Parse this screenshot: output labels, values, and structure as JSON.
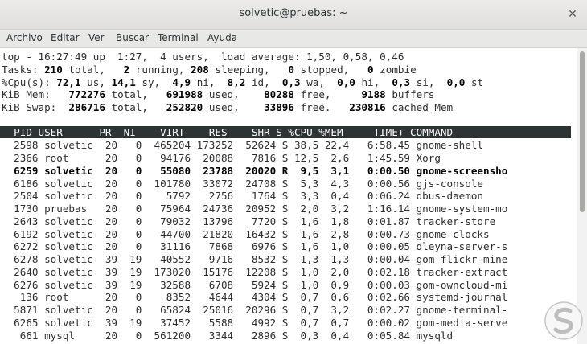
{
  "window": {
    "title": "solvetic@pruebas: ~"
  },
  "menu": [
    "Archivo",
    "Editar",
    "Ver",
    "Buscar",
    "Terminal",
    "Ayuda"
  ],
  "summary": [
    "top - 16:27:49 up  1:27,  4 users,  load average: 1,50, 0,58, 0,46",
    "Tasks: <b>210</b> total,   <b>2</b> running, <b>208</b> sleeping,   <b>0</b> stopped,   <b>0</b> zombie",
    "%Cpu(s): <b>72,1</b> us, <b>14,1</b> sy,  <b>4,9</b> ni,  <b>8,2</b> id,  <b>0,3</b> wa,  <b>0,0</b> hi,  <b>0,3</b> si,  <b>0,0</b> st",
    "KiB Mem:   <b>772276</b> total,   <b>691988</b> used,    <b>80288</b> free,     <b>9188</b> buffers",
    "KiB Swap:  <b>286716</b> total,   <b>252820</b> used,    <b>33896</b> free.   <b>230816</b> cached Mem"
  ],
  "table_header": "  PID USER      PR  NI    VIRT    RES    SHR S %CPU %MEM     TIME+ COMMAND",
  "processes": [
    "  2598 solvetic  20   0  465204 173252  52624 S 38,5 22,4   6:58.45 gnome-shell",
    "  2366 root      20   0   94176  20088   7816 S 12,5  2,6   1:45.59 Xorg",
    "  6259 solvetic  20   0   55080  23788  20020 R  9,5  3,1   0:00.50 gnome-screensho",
    "  6186 solvetic  20   0  101780  33072  24708 S  5,3  4,3   0:00.56 gjs-console",
    "  2504 solvetic  20   0    5792   2756   1764 S  3,3  0,4   0:06.24 dbus-daemon",
    "  1730 pruebas   20   0   75964  24736  20952 S  2,0  3,2   1:16.14 gnome-system-mo",
    "  2643 solvetic  20   0   79032  13796   7720 S  1,6  1,8   0:01.87 tracker-store",
    "  6192 solvetic  20   0   44700  21820  16432 S  1,6  2,8   0:00.73 gnome-clocks",
    "  6272 solvetic  20   0   31116   7868   6976 S  1,6  1,0   0:00.05 dleyna-server-s",
    "  6278 solvetic  39  19   40552   9716   8532 S  1,3  1,3   0:00.04 gom-flickr-mine",
    "  2640 solvetic  39  19  173020  15176  12208 S  1,0  2,0   0:02.18 tracker-extract",
    "  6276 solvetic  39  19   32588   6708   5924 S  1,0  0,9   0:00.03 gom-owncloud-mi",
    "   136 root      20   0    8352   4644   4304 S  0,7  0,6   0:02.66 systemd-journal",
    "  5871 solvetic  20   0   65824  25016  20296 S  0,7  3,2   0:02.27 gnome-terminal-",
    "  6265 solvetic  39  19   37452   5588   4992 S  0,7  0,7   0:00.02 gom-media-serve",
    "   661 mysql     20   0  561200   3344   2896 S  0,3  0,4   0:05.84 mysqld"
  ],
  "bold_process_index": 2,
  "icons": {
    "close": "close-icon",
    "logo": "solvetic-logo-icon"
  }
}
